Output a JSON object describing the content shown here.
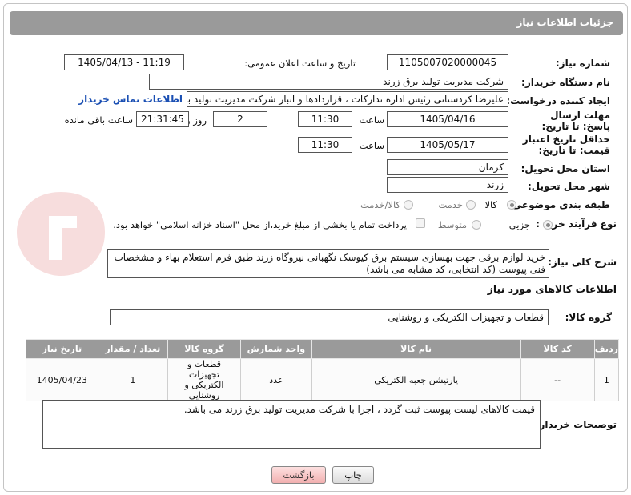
{
  "header": {
    "title": "جزئیات اطلاعات نیاز"
  },
  "fields": {
    "need_number_label": "شماره نیاز:",
    "need_number": "1105007020000045",
    "announce_label": "تاریخ و ساعت اعلان عمومی:",
    "announce_value": "1405/04/13 - 11:19",
    "buyer_org_label": "نام دستگاه خریدار:",
    "buyer_org": "شرکت مدیریت تولید برق زرند",
    "requester_label": "ایجاد کننده درخواست:",
    "requester": "علیرضا کردستانی رئیس اداره تدارکات ، قراردادها و انبار  شرکت مدیریت تولید برق زرند",
    "buyer_contact_link": "اطلاعات تماس خریدار",
    "reply_deadline_label": "مهلت ارسال پاسخ: تا تاریخ:",
    "reply_date": "1405/04/16",
    "time_label": "ساعت",
    "reply_time": "11:30",
    "days_value": "2",
    "days_label": "روز و",
    "remaining_time": "21:31:45",
    "remaining_label": "ساعت باقی مانده",
    "price_validity_label": "حداقل تاریخ اعتبار قیمت: تا تاریخ:",
    "price_date": "1405/05/17",
    "price_time": "11:30",
    "province_label": "استان محل تحویل:",
    "province": "کرمان",
    "city_label": "شهر محل تحویل:",
    "city": "زرند",
    "category_label": "طبقه بندی موضوعی:",
    "category_options": [
      "کالا",
      "خدمت",
      "کالا/خدمت"
    ],
    "process_label": "نوع فرآیند خرید :",
    "process_options": [
      "جزیی",
      "متوسط"
    ],
    "payment_note": "پرداخت تمام یا بخشی از مبلغ خرید،از محل \"اسناد خزانه اسلامی\" خواهد بود."
  },
  "description": {
    "label": "شرح کلی نیاز:",
    "text": "خرید لوازم برقی جهت بهسازی سیستم برق کیوسک نگهبانی نیروگاه زرند طبق فرم استعلام بهاء و مشخصات فنی پیوست (کد انتخابی، کد مشابه می باشد)"
  },
  "goods_info": {
    "section_title": "اطلاعات کالاهای مورد نیاز",
    "group_label": "گروه کالا:",
    "group_value": "قطعات و تجهیزات الکتریکی و روشنایی"
  },
  "table": {
    "headers": [
      "ردیف",
      "کد کالا",
      "نام کالا",
      "واحد شمارش",
      "گروه کالا",
      "تعداد / مقدار",
      "تاریخ نیاز"
    ],
    "rows": [
      [
        "1",
        "--",
        "پارتیشن جعبه الکتریکی",
        "عدد",
        "قطعات و تجهیزات الکتریکی و روشنایی",
        "1",
        "1405/04/23"
      ]
    ]
  },
  "buyer_notes": {
    "label": "توضیحات خریدار:",
    "text": "قیمت کالاهای لیست پیوست ثبت گردد ، اجرا با شرکت مدیریت تولید برق زرند می باشد."
  },
  "buttons": {
    "print": "چاپ",
    "back": "بازگشت"
  },
  "colors": {
    "header_bg": "#9a9a9a",
    "link": "#1a4fb3",
    "back_button": "#f2b0b0"
  }
}
